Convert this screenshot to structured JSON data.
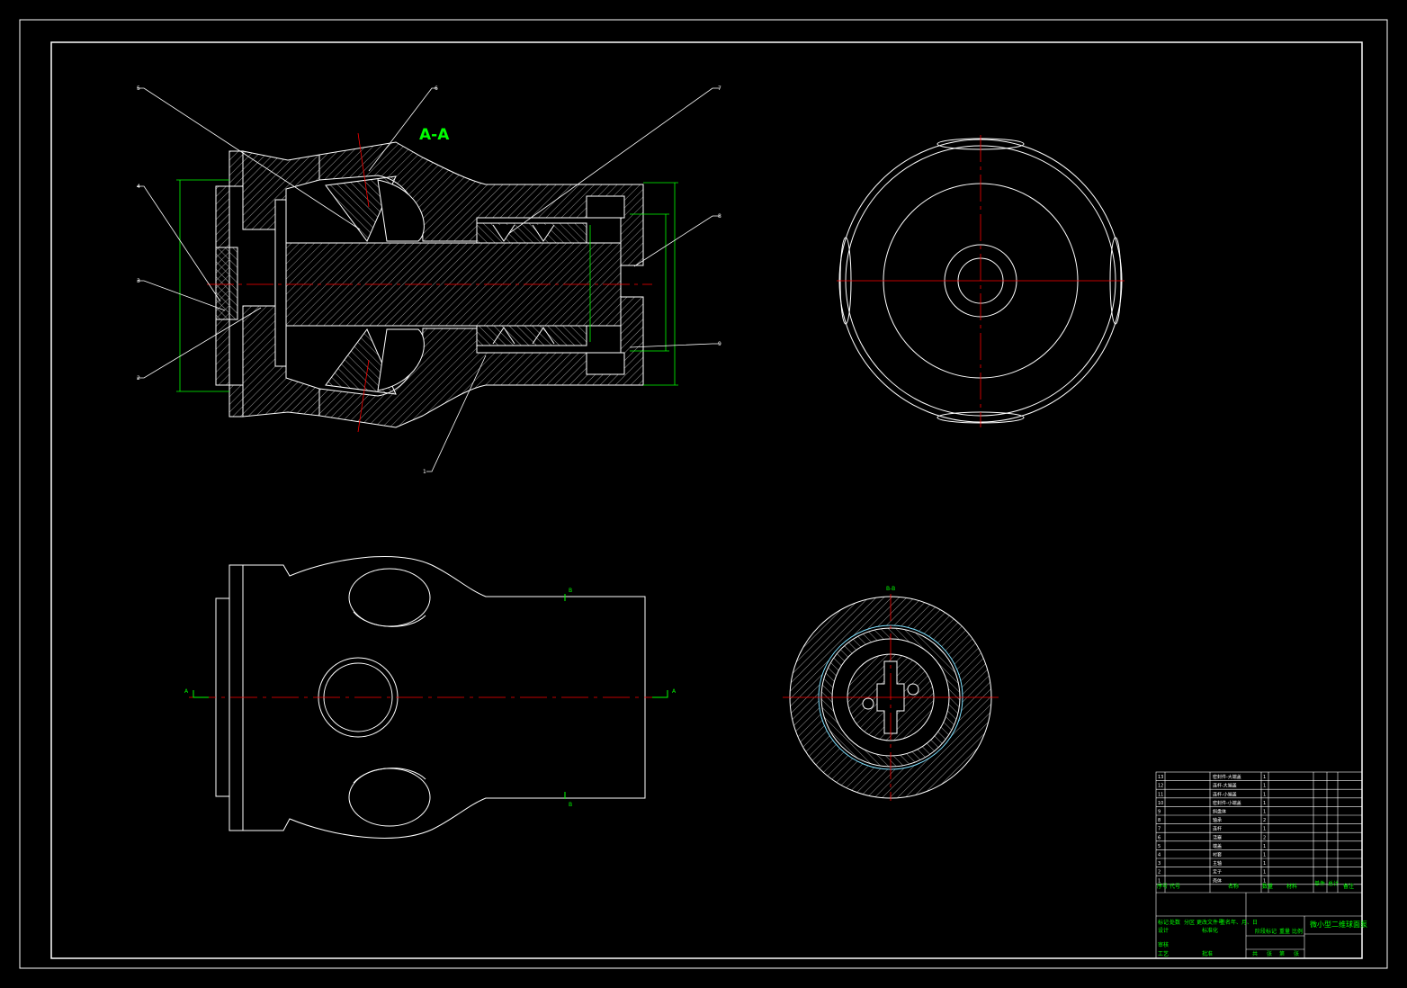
{
  "drawing": {
    "section_title": "A-A",
    "colors": {
      "background": "#000000",
      "outline": "#ffffff",
      "centerline": "#ff0000",
      "dimension": "#00ff00",
      "hatch": "#bdbdbd",
      "inner_ring": "#7ee0ff"
    },
    "balloons": [
      "5",
      "6",
      "7",
      "4",
      "8",
      "3",
      "9",
      "2",
      "1"
    ],
    "section_marks": [
      "A",
      "A",
      "B",
      "B",
      "B-B"
    ]
  },
  "title_block": {
    "drawing_title": "微小型二维球面泵",
    "bom_header": [
      "序号",
      "代号",
      "名称",
      "数量",
      "材料",
      "单件",
      "总计",
      "备注"
    ],
    "bom_rows": [
      {
        "no": "13",
        "name": "密封件-大端盖",
        "qty": "1"
      },
      {
        "no": "12",
        "name": "连杆-大端盖",
        "qty": "1"
      },
      {
        "no": "11",
        "name": "连杆-小端盖",
        "qty": "1"
      },
      {
        "no": "10",
        "name": "密封件-小端盖",
        "qty": "1"
      },
      {
        "no": "9",
        "name": "斜盘体",
        "qty": "1"
      },
      {
        "no": "8",
        "name": "轴承",
        "qty": "2"
      },
      {
        "no": "7",
        "name": "连杆",
        "qty": "1"
      },
      {
        "no": "6",
        "name": "活塞",
        "qty": "2"
      },
      {
        "no": "5",
        "name": "端盖",
        "qty": "1"
      },
      {
        "no": "4",
        "name": "衬套",
        "qty": "1"
      },
      {
        "no": "3",
        "name": "主轴",
        "qty": "1"
      },
      {
        "no": "2",
        "name": "定子",
        "qty": "1"
      },
      {
        "no": "1",
        "name": "壳体",
        "qty": "1"
      }
    ],
    "approval_labels": [
      "标记",
      "处数",
      "分区",
      "更改文件号",
      "签名",
      "年、月、日",
      "设计",
      "标准化",
      "审核",
      "工艺",
      "批准",
      "阶段标记",
      "重量",
      "比例",
      "共",
      "张",
      "第",
      "张"
    ]
  }
}
